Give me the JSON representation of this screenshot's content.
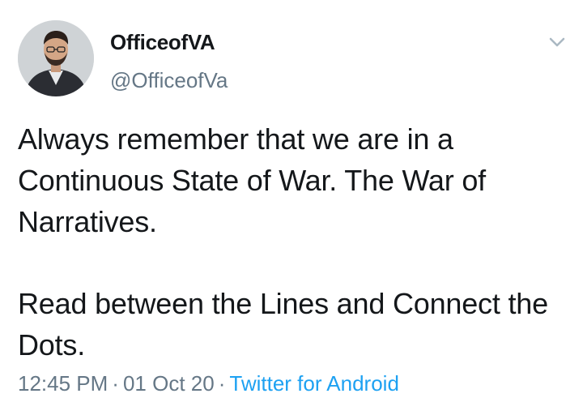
{
  "user": {
    "display_name": "OfficeofVA",
    "handle": "@OfficeofVa"
  },
  "tweet": {
    "paragraphs": [
      "Always remember that we are in a Continuous State of War. The War of Narratives.",
      "Read between the Lines and Connect the Dots."
    ],
    "time": "12:45 PM",
    "date": "01 Oct 20",
    "separator": "·",
    "source": "Twitter for Android"
  },
  "icons": {
    "menu": "chevron-down-icon",
    "avatar": "profile-photo"
  },
  "colors": {
    "text": "#14171a",
    "secondary": "#657786",
    "link": "#1da1f2",
    "background": "#ffffff"
  }
}
